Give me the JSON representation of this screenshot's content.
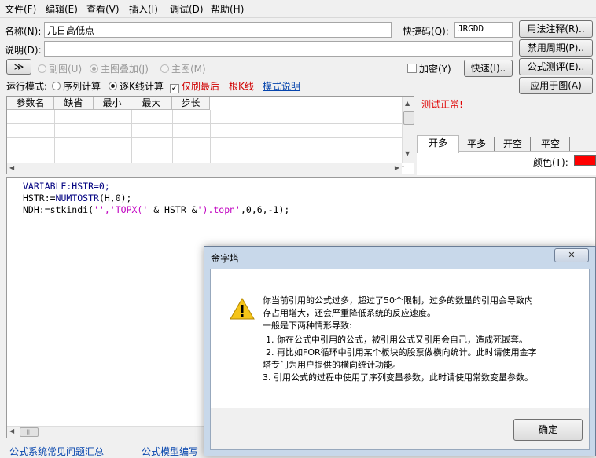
{
  "menubar": {
    "items": [
      "文件(F)",
      "编辑(E)",
      "查看(V)",
      "插入(I)",
      "调试(D)",
      "帮助(H)"
    ]
  },
  "form": {
    "name_label": "名称(N):",
    "name_value": "几日高低点",
    "shortcode_label": "快捷码(Q):",
    "shortcode_value": "JRGDD",
    "desc_label": "说明(D):",
    "desc_value": "",
    "expand_button": "≫",
    "chart_mode": {
      "sub": "副图(U)",
      "overlay": "主图叠加(J)",
      "main": "主图(M)",
      "selected": "主图叠加(J)"
    },
    "encrypt_label": "加密(Y)",
    "quick_button": "快速(I)..",
    "run_mode_label": "运行模式:",
    "run_mode_serial": "序列计算",
    "run_mode_kline": "逐K线计算",
    "run_mode_selected": "逐K线计算",
    "only_last_label": "仅刷最后一根K线",
    "only_last_checked": true,
    "mode_help_link": "模式说明"
  },
  "right_buttons": {
    "usage": "用法注释(R)..",
    "forbid_period": "禁用周期(P)..",
    "formula_eval": "公式测评(E)..",
    "apply_to_chart": "应用于图(A)"
  },
  "param_table": {
    "headers": [
      "参数名",
      "缺省",
      "最小",
      "最大",
      "步长"
    ],
    "rows": [
      [
        "",
        "",
        "",
        "",
        ""
      ],
      [
        "",
        "",
        "",
        "",
        ""
      ],
      [
        "",
        "",
        "",
        "",
        ""
      ],
      [
        "",
        "",
        "",
        "",
        ""
      ]
    ]
  },
  "status": {
    "text": "测试正常!",
    "color": "#e00000"
  },
  "signal_tabs": [
    "开多",
    "平多",
    "开空",
    "平空"
  ],
  "signal_tab_active": "开多",
  "color_label": "颜色(T):",
  "color_swatch": "#ff0000",
  "code": {
    "line1": "VARIABLE:HSTR=0;",
    "line2": "HSTR:=NUMTOSTR(H,0);",
    "line3_a": "NDH:=stkindi(",
    "line3_str1": "'',",
    "line3_str2": "'TOPX('",
    "line3_b": "& HSTR &",
    "line3_str3": "').topn'",
    "line3_c": ",0,6,-1);"
  },
  "bottom_links": [
    "公式系统常见问题汇总",
    "公式模型编写"
  ],
  "dialog": {
    "title": "金字塔",
    "close_icon": "close-icon",
    "icon": "warning-icon",
    "lines": [
      "你当前引用的公式过多，超过了50个限制，过多的数量的引用会导致内",
      "存占用增大，还会严重降低系统的反应速度。",
      "一般是下两种情形导致:",
      "1. 你在公式中引用的公式，被引用公式又引用会自己，造成死嵌套。",
      "2. 再比如FOR循环中引用某个板块的股票做横向统计。此时请使用金字",
      "塔专门为用户提供的横向统计功能。",
      "3. 引用公式的过程中使用了序列变量参数，此时请使用常数变量参数。"
    ],
    "ok_button": "确定"
  }
}
